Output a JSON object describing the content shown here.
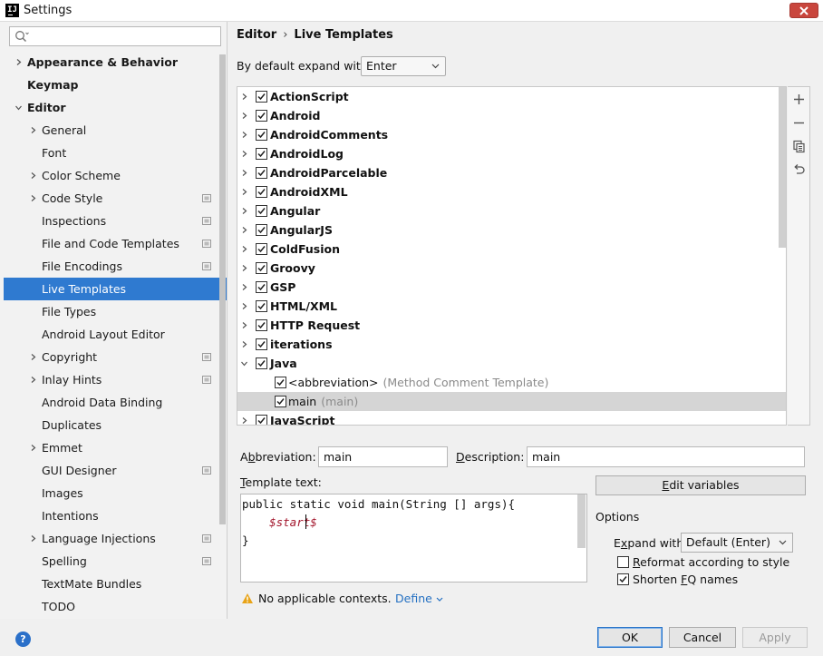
{
  "window": {
    "title": "Settings",
    "logo": "IJ"
  },
  "search": {
    "placeholder": "",
    "value": ""
  },
  "sidebar": {
    "items": [
      {
        "label": "Appearance & Behavior",
        "bold": true,
        "level": 0,
        "expander": "collapsed",
        "project": false
      },
      {
        "label": "Keymap",
        "bold": true,
        "level": 0,
        "expander": "none",
        "project": false
      },
      {
        "label": "Editor",
        "bold": true,
        "level": 0,
        "expander": "expanded",
        "project": false
      },
      {
        "label": "General",
        "level": 1,
        "expander": "collapsed",
        "project": false
      },
      {
        "label": "Font",
        "level": 1,
        "expander": "none",
        "project": false
      },
      {
        "label": "Color Scheme",
        "level": 1,
        "expander": "collapsed",
        "project": false
      },
      {
        "label": "Code Style",
        "level": 1,
        "expander": "collapsed",
        "project": true
      },
      {
        "label": "Inspections",
        "level": 1,
        "expander": "none",
        "project": true
      },
      {
        "label": "File and Code Templates",
        "level": 1,
        "expander": "none",
        "project": true
      },
      {
        "label": "File Encodings",
        "level": 1,
        "expander": "none",
        "project": true
      },
      {
        "label": "Live Templates",
        "level": 1,
        "expander": "none",
        "project": false,
        "selected": true
      },
      {
        "label": "File Types",
        "level": 1,
        "expander": "none",
        "project": false
      },
      {
        "label": "Android Layout Editor",
        "level": 1,
        "expander": "none",
        "project": false
      },
      {
        "label": "Copyright",
        "level": 1,
        "expander": "collapsed",
        "project": true
      },
      {
        "label": "Inlay Hints",
        "level": 1,
        "expander": "collapsed",
        "project": true
      },
      {
        "label": "Android Data Binding",
        "level": 1,
        "expander": "none",
        "project": false
      },
      {
        "label": "Duplicates",
        "level": 1,
        "expander": "none",
        "project": false
      },
      {
        "label": "Emmet",
        "level": 1,
        "expander": "collapsed",
        "project": false
      },
      {
        "label": "GUI Designer",
        "level": 1,
        "expander": "none",
        "project": true
      },
      {
        "label": "Images",
        "level": 1,
        "expander": "none",
        "project": false
      },
      {
        "label": "Intentions",
        "level": 1,
        "expander": "none",
        "project": false
      },
      {
        "label": "Language Injections",
        "level": 1,
        "expander": "collapsed",
        "project": true
      },
      {
        "label": "Spelling",
        "level": 1,
        "expander": "none",
        "project": true
      },
      {
        "label": "TextMate Bundles",
        "level": 1,
        "expander": "none",
        "project": false
      },
      {
        "label": "TODO",
        "level": 1,
        "expander": "none",
        "project": false
      }
    ]
  },
  "breadcrumb": {
    "parent": "Editor",
    "separator": "›",
    "current": "Live Templates"
  },
  "expand_default": {
    "label": "By default expand with",
    "value": "Enter"
  },
  "templates": [
    {
      "label": "ActionScript",
      "level": 0,
      "checked": true,
      "expander": "collapsed"
    },
    {
      "label": "Android",
      "level": 0,
      "checked": true,
      "expander": "collapsed"
    },
    {
      "label": "AndroidComments",
      "level": 0,
      "checked": true,
      "expander": "collapsed"
    },
    {
      "label": "AndroidLog",
      "level": 0,
      "checked": true,
      "expander": "collapsed"
    },
    {
      "label": "AndroidParcelable",
      "level": 0,
      "checked": true,
      "expander": "collapsed"
    },
    {
      "label": "AndroidXML",
      "level": 0,
      "checked": true,
      "expander": "collapsed"
    },
    {
      "label": "Angular",
      "level": 0,
      "checked": true,
      "expander": "collapsed"
    },
    {
      "label": "AngularJS",
      "level": 0,
      "checked": true,
      "expander": "collapsed"
    },
    {
      "label": "ColdFusion",
      "level": 0,
      "checked": true,
      "expander": "collapsed"
    },
    {
      "label": "Groovy",
      "level": 0,
      "checked": true,
      "expander": "collapsed"
    },
    {
      "label": "GSP",
      "level": 0,
      "checked": true,
      "expander": "collapsed"
    },
    {
      "label": "HTML/XML",
      "level": 0,
      "checked": true,
      "expander": "collapsed"
    },
    {
      "label": "HTTP Request",
      "level": 0,
      "checked": true,
      "expander": "collapsed"
    },
    {
      "label": "iterations",
      "level": 0,
      "checked": true,
      "expander": "collapsed"
    },
    {
      "label": "Java",
      "level": 0,
      "checked": true,
      "expander": "expanded"
    },
    {
      "label": "<abbreviation>",
      "desc": "(Method Comment Template)",
      "level": 1,
      "checked": true,
      "expander": "none"
    },
    {
      "label": "main",
      "desc": "(main)",
      "level": 1,
      "checked": true,
      "expander": "none",
      "selected": true
    },
    {
      "label": "JavaScript",
      "level": 0,
      "checked": true,
      "expander": "collapsed"
    }
  ],
  "toolbar_icons": [
    "plus-icon",
    "minus-icon",
    "copy-icon",
    "revert-icon"
  ],
  "abbreviation": {
    "label_pre": "A",
    "label_mn": "b",
    "label_post": "breviation:",
    "value": "main"
  },
  "description": {
    "label_mn": "D",
    "label_post": "escription:",
    "value": "main"
  },
  "template_text": {
    "label_mn": "T",
    "label_post": "emplate text:",
    "line1": "public static void main(String [] args){",
    "line2_indent": "    ",
    "line2_var": "$start$",
    "line3": "}"
  },
  "edit_variables": {
    "label_mn": "E",
    "label_post": "dit variables"
  },
  "options": {
    "title": "Options",
    "expand_with": {
      "label_pre": "E",
      "label_mn": "x",
      "label_post": "pand with",
      "value": "Default (Enter)"
    },
    "reformat": {
      "label_mn": "R",
      "label_post": "eformat according to style",
      "checked": false
    },
    "shorten": {
      "label_pre": "Shorten ",
      "label_mn": "F",
      "label_post": "Q names",
      "checked": true
    }
  },
  "contexts": {
    "warning": "No applicable contexts.",
    "define": "Define"
  },
  "buttons": {
    "ok": "OK",
    "cancel": "Cancel",
    "apply": "Apply",
    "help": "?"
  },
  "colors": {
    "selection": "#2f7ad0",
    "list_selection": "#d5d5d5",
    "link": "#2470c2",
    "close": "#c9463d",
    "template_var": "#a3162c"
  }
}
